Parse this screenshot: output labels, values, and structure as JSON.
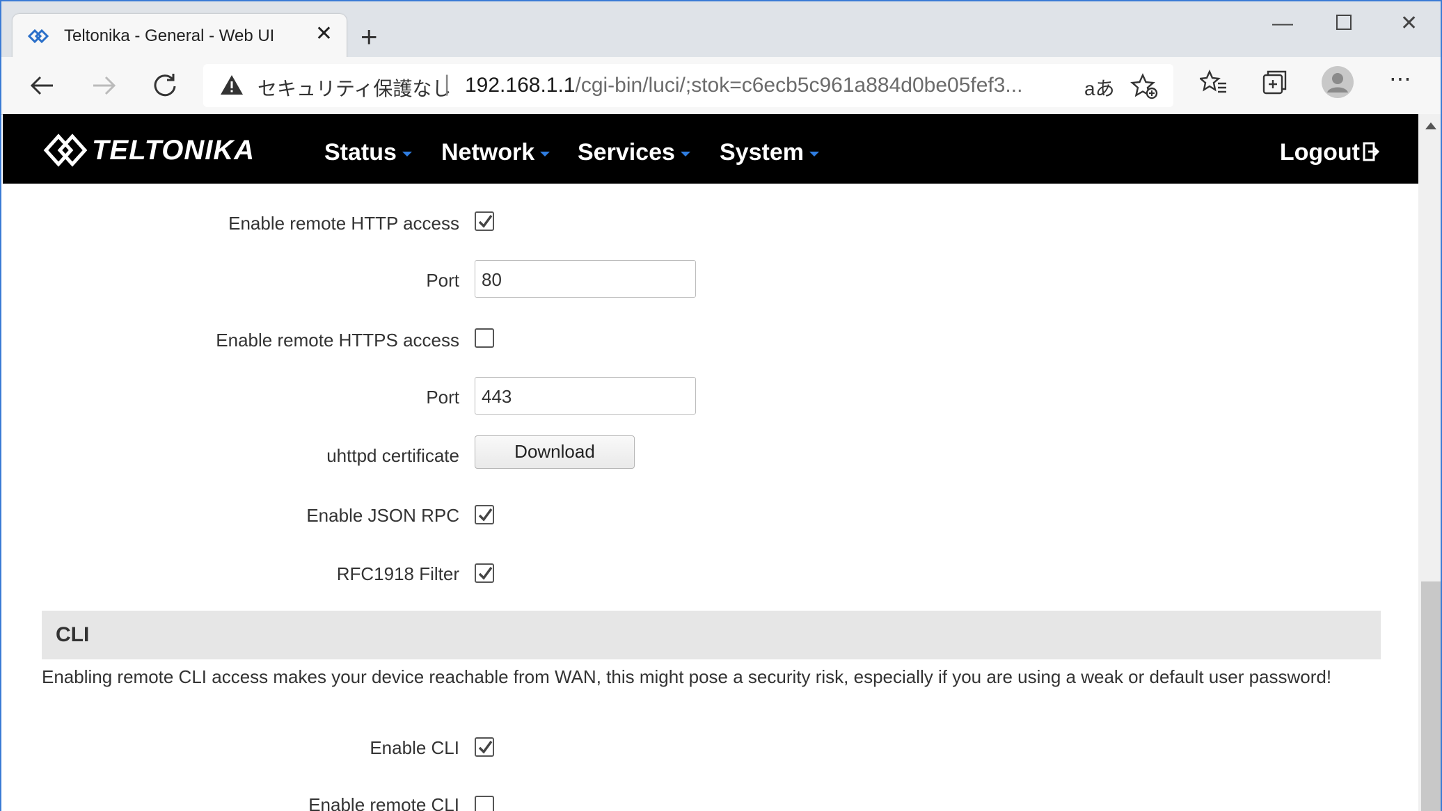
{
  "browser": {
    "tab_title": "Teltonika - General - Web UI",
    "security_label": "セキュリティ保護なし",
    "url_host": "192.168.1.1",
    "url_path": "/cgi-bin/luci/;stok=c6ecb5c961a884d0be05fef3...",
    "read_aloud_label": "aあ"
  },
  "header": {
    "brand": "TELTONIKA",
    "menu": [
      {
        "label": "Status"
      },
      {
        "label": "Network"
      },
      {
        "label": "Services"
      },
      {
        "label": "System"
      }
    ],
    "logout": "Logout"
  },
  "form": {
    "http_access_label": "Enable remote HTTP access",
    "http_access_checked": true,
    "http_port_label": "Port",
    "http_port_value": "80",
    "https_access_label": "Enable remote HTTPS access",
    "https_access_checked": false,
    "https_port_label": "Port",
    "https_port_value": "443",
    "cert_label": "uhttpd certificate",
    "cert_button": "Download",
    "json_rpc_label": "Enable JSON RPC",
    "json_rpc_checked": true,
    "rfc1918_label": "RFC1918 Filter",
    "rfc1918_checked": true
  },
  "cli": {
    "section_title": "CLI",
    "warning": "Enabling remote CLI access makes your device reachable from WAN, this might pose a security risk, especially if you are using a weak or default user password!",
    "enable_cli_label": "Enable CLI",
    "enable_cli_checked": true,
    "remote_cli_label": "Enable remote CLI",
    "remote_cli_checked": false
  },
  "colors": {
    "header_bg": "#000000",
    "caret_accent": "#2f7de1",
    "section_bg": "#e6e6e6"
  }
}
